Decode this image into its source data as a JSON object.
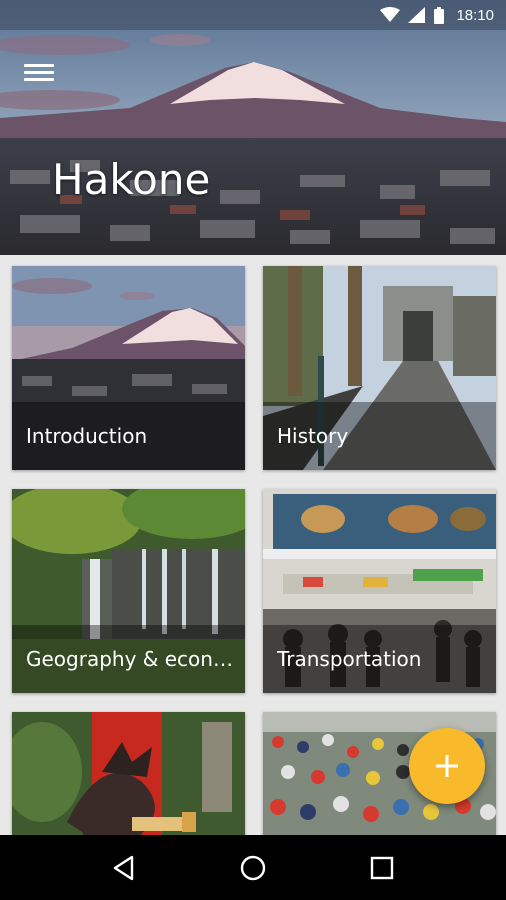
{
  "status_bar": {
    "time": "18:10",
    "icons": [
      "wifi-icon",
      "cellular-signal-icon",
      "battery-icon"
    ]
  },
  "header": {
    "title": "Hakone",
    "menu_icon": "hamburger-menu-icon"
  },
  "cards": [
    {
      "label": "Introduction"
    },
    {
      "label": "History"
    },
    {
      "label": "Geography & economy"
    },
    {
      "label": "Transportation"
    },
    {
      "label": ""
    },
    {
      "label": ""
    }
  ],
  "fab": {
    "icon": "plus-icon",
    "color": "#f8b92b"
  },
  "nav_bar": {
    "icons": [
      "back-icon",
      "home-icon",
      "recents-icon"
    ]
  }
}
